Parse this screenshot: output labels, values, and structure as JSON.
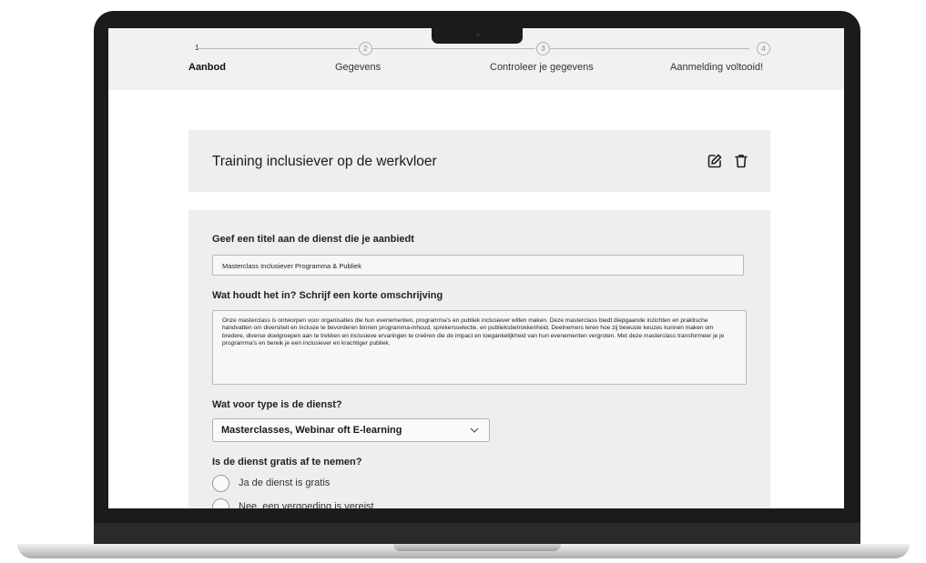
{
  "steps": [
    {
      "number": "1",
      "label": "Aanbod",
      "active": true
    },
    {
      "number": "2",
      "label": "Gegevens",
      "active": false
    },
    {
      "number": "3",
      "label": "Controleer je gegevens",
      "active": false
    },
    {
      "number": "4",
      "label": "Aanmelding voltooid!",
      "active": false
    }
  ],
  "card": {
    "title": "Training inclusiever op de werkvloer",
    "edit_icon": "edit-icon",
    "delete_icon": "trash-icon"
  },
  "form": {
    "title_question": "Geef een titel aan de dienst die je aanbiedt",
    "title_value": "Masterclass Inclusiever Programma & Publiek",
    "description_question": "Wat houdt het in? Schrijf een korte omschrijving",
    "description_value": "Onze masterclass is ontworpen voor organisaties die hun evenementen, programma's en publiek inclusiever willen maken. Deze masterclass biedt diepgaande inzichten en praktische handvatten om diversiteit en inclusie te bevorderen binnen programma-inhoud, sprekersselectie, en publieksbetrokkenheid. Deelnemers leren hoe zij bewuste keuzes kunnen maken om bredere, diverse doelgroepen aan te trekken en inclusieve ervaringen te creëren die de impact en toegankelijkheid van hun evenementen vergroten. Met deze masterclass transformeer je je programma's en bereik je een inclusiever en krachtiger publiek.",
    "type_question": "Wat voor type is de dienst?",
    "type_value": "Masterclasses, Webinar oft E-learning",
    "free_question": "Is de dienst gratis af te nemen?",
    "free_options": [
      "Ja de dienst is gratis",
      "Nee, een vergoeding is vereist"
    ]
  }
}
